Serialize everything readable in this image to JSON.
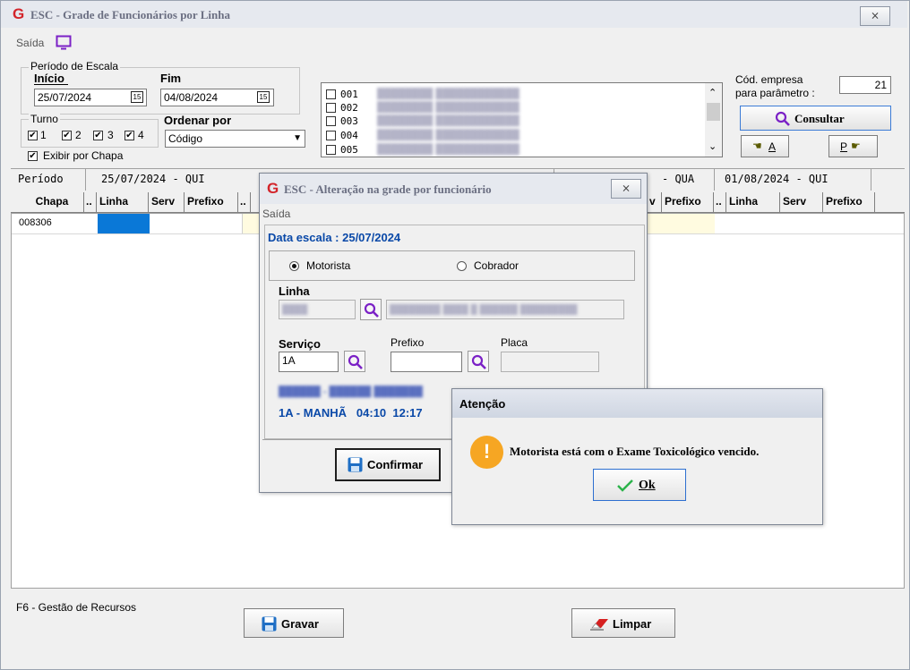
{
  "main": {
    "title": "ESC - Grade de Funcionários por Linha",
    "close_glyph": "⨯",
    "menu_saida": "Saída",
    "periodo_label": "Período de Escala",
    "inicio_label": "Início",
    "inicio_value": "25/07/2024",
    "fim_label": "Fim",
    "fim_value": "04/08/2024",
    "calendar_glyph": "15",
    "turno_label": "Turno",
    "turnos": [
      "1",
      "2",
      "3",
      "4"
    ],
    "ordenar_label": "Ordenar por",
    "ordenar_value": "Código",
    "exibir_label": "Exibir por Chapa",
    "list_codes": [
      "001",
      "002",
      "003",
      "004",
      "005"
    ],
    "cod_empresa_label1": "Cód. empresa",
    "cod_empresa_label2": "para parâmetro :",
    "cod_empresa_value": "21",
    "consultar_label": "Consultar",
    "nav_a": "A",
    "nav_p": "P",
    "grid_periodo": "Período",
    "grid_dates": [
      "25/07/2024 - QUI",
      "- QUA",
      "01/08/2024 - QUI"
    ],
    "grid_columns_left": [
      "Chapa",
      "..",
      "Linha",
      "Serv",
      "Prefixo",
      ".."
    ],
    "grid_columns_right": [
      "v",
      "Prefixo",
      "..",
      "Linha",
      "Serv",
      "Prefixo"
    ],
    "row_chapa": "008306",
    "status_text": "F6 - Gestão de Recursos",
    "gravar_label": "Gravar",
    "limpar_label": "Limpar"
  },
  "alteracao": {
    "title": "ESC - Alteração na grade por funcionário",
    "menu_saida": "Saída",
    "data_escala": "Data escala : 25/07/2024",
    "motorista_label": "Motorista",
    "cobrador_label": "Cobrador",
    "selected_role": "Motorista",
    "linha_label": "Linha",
    "servico_label": "Serviço",
    "servico_value": "1A",
    "prefixo_label": "Prefixo",
    "placa_label": "Placa",
    "shift_info": "1A - MANHÃ   04:10  12:17",
    "confirmar_label": "Confirmar"
  },
  "atencao": {
    "title": "Atenção",
    "message": "Motorista está com o Exame Toxicológico vencido.",
    "ok_label": "Ok",
    "icon_glyph": "!"
  },
  "colors": {
    "accent_blue": "#0a49a8",
    "alert_orange": "#f6a623",
    "selected_cell": "#0a78d7",
    "search_purple": "#7b21c6",
    "gravar_blue": "#1f6fc5",
    "limpar_red": "#d62020"
  }
}
